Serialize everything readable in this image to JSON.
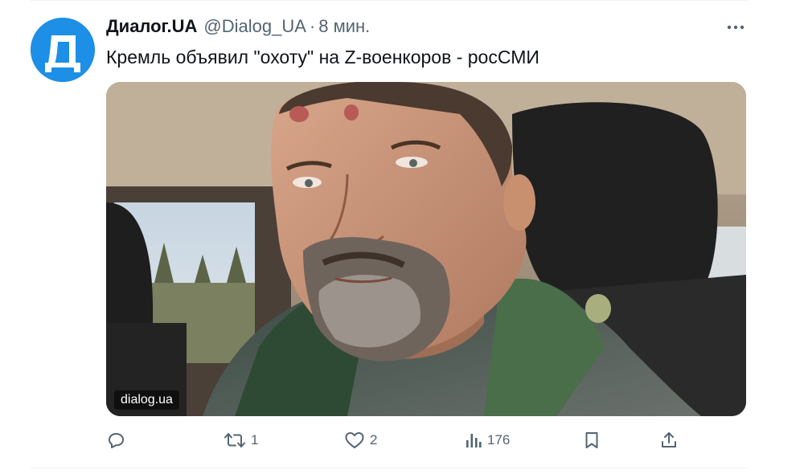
{
  "tweet": {
    "author_name": "Диалог.UA",
    "handle": "@Dialog_UA",
    "separator": "·",
    "time": "8 мин.",
    "avatar_letter": "Д",
    "text": "Кремль объявил \"охоту\" на Z-военкоров - росСМИ",
    "media": {
      "watermark": "dialog.ua",
      "description_icon": "photo-man-in-car"
    },
    "actions": {
      "reply_count": "",
      "retweet_count": "1",
      "like_count": "2",
      "views_count": "176"
    }
  },
  "colors": {
    "text_primary": "#0f1419",
    "text_secondary": "#536471",
    "avatar_bg": "#1d8fe6",
    "divider": "#eff3f4"
  }
}
